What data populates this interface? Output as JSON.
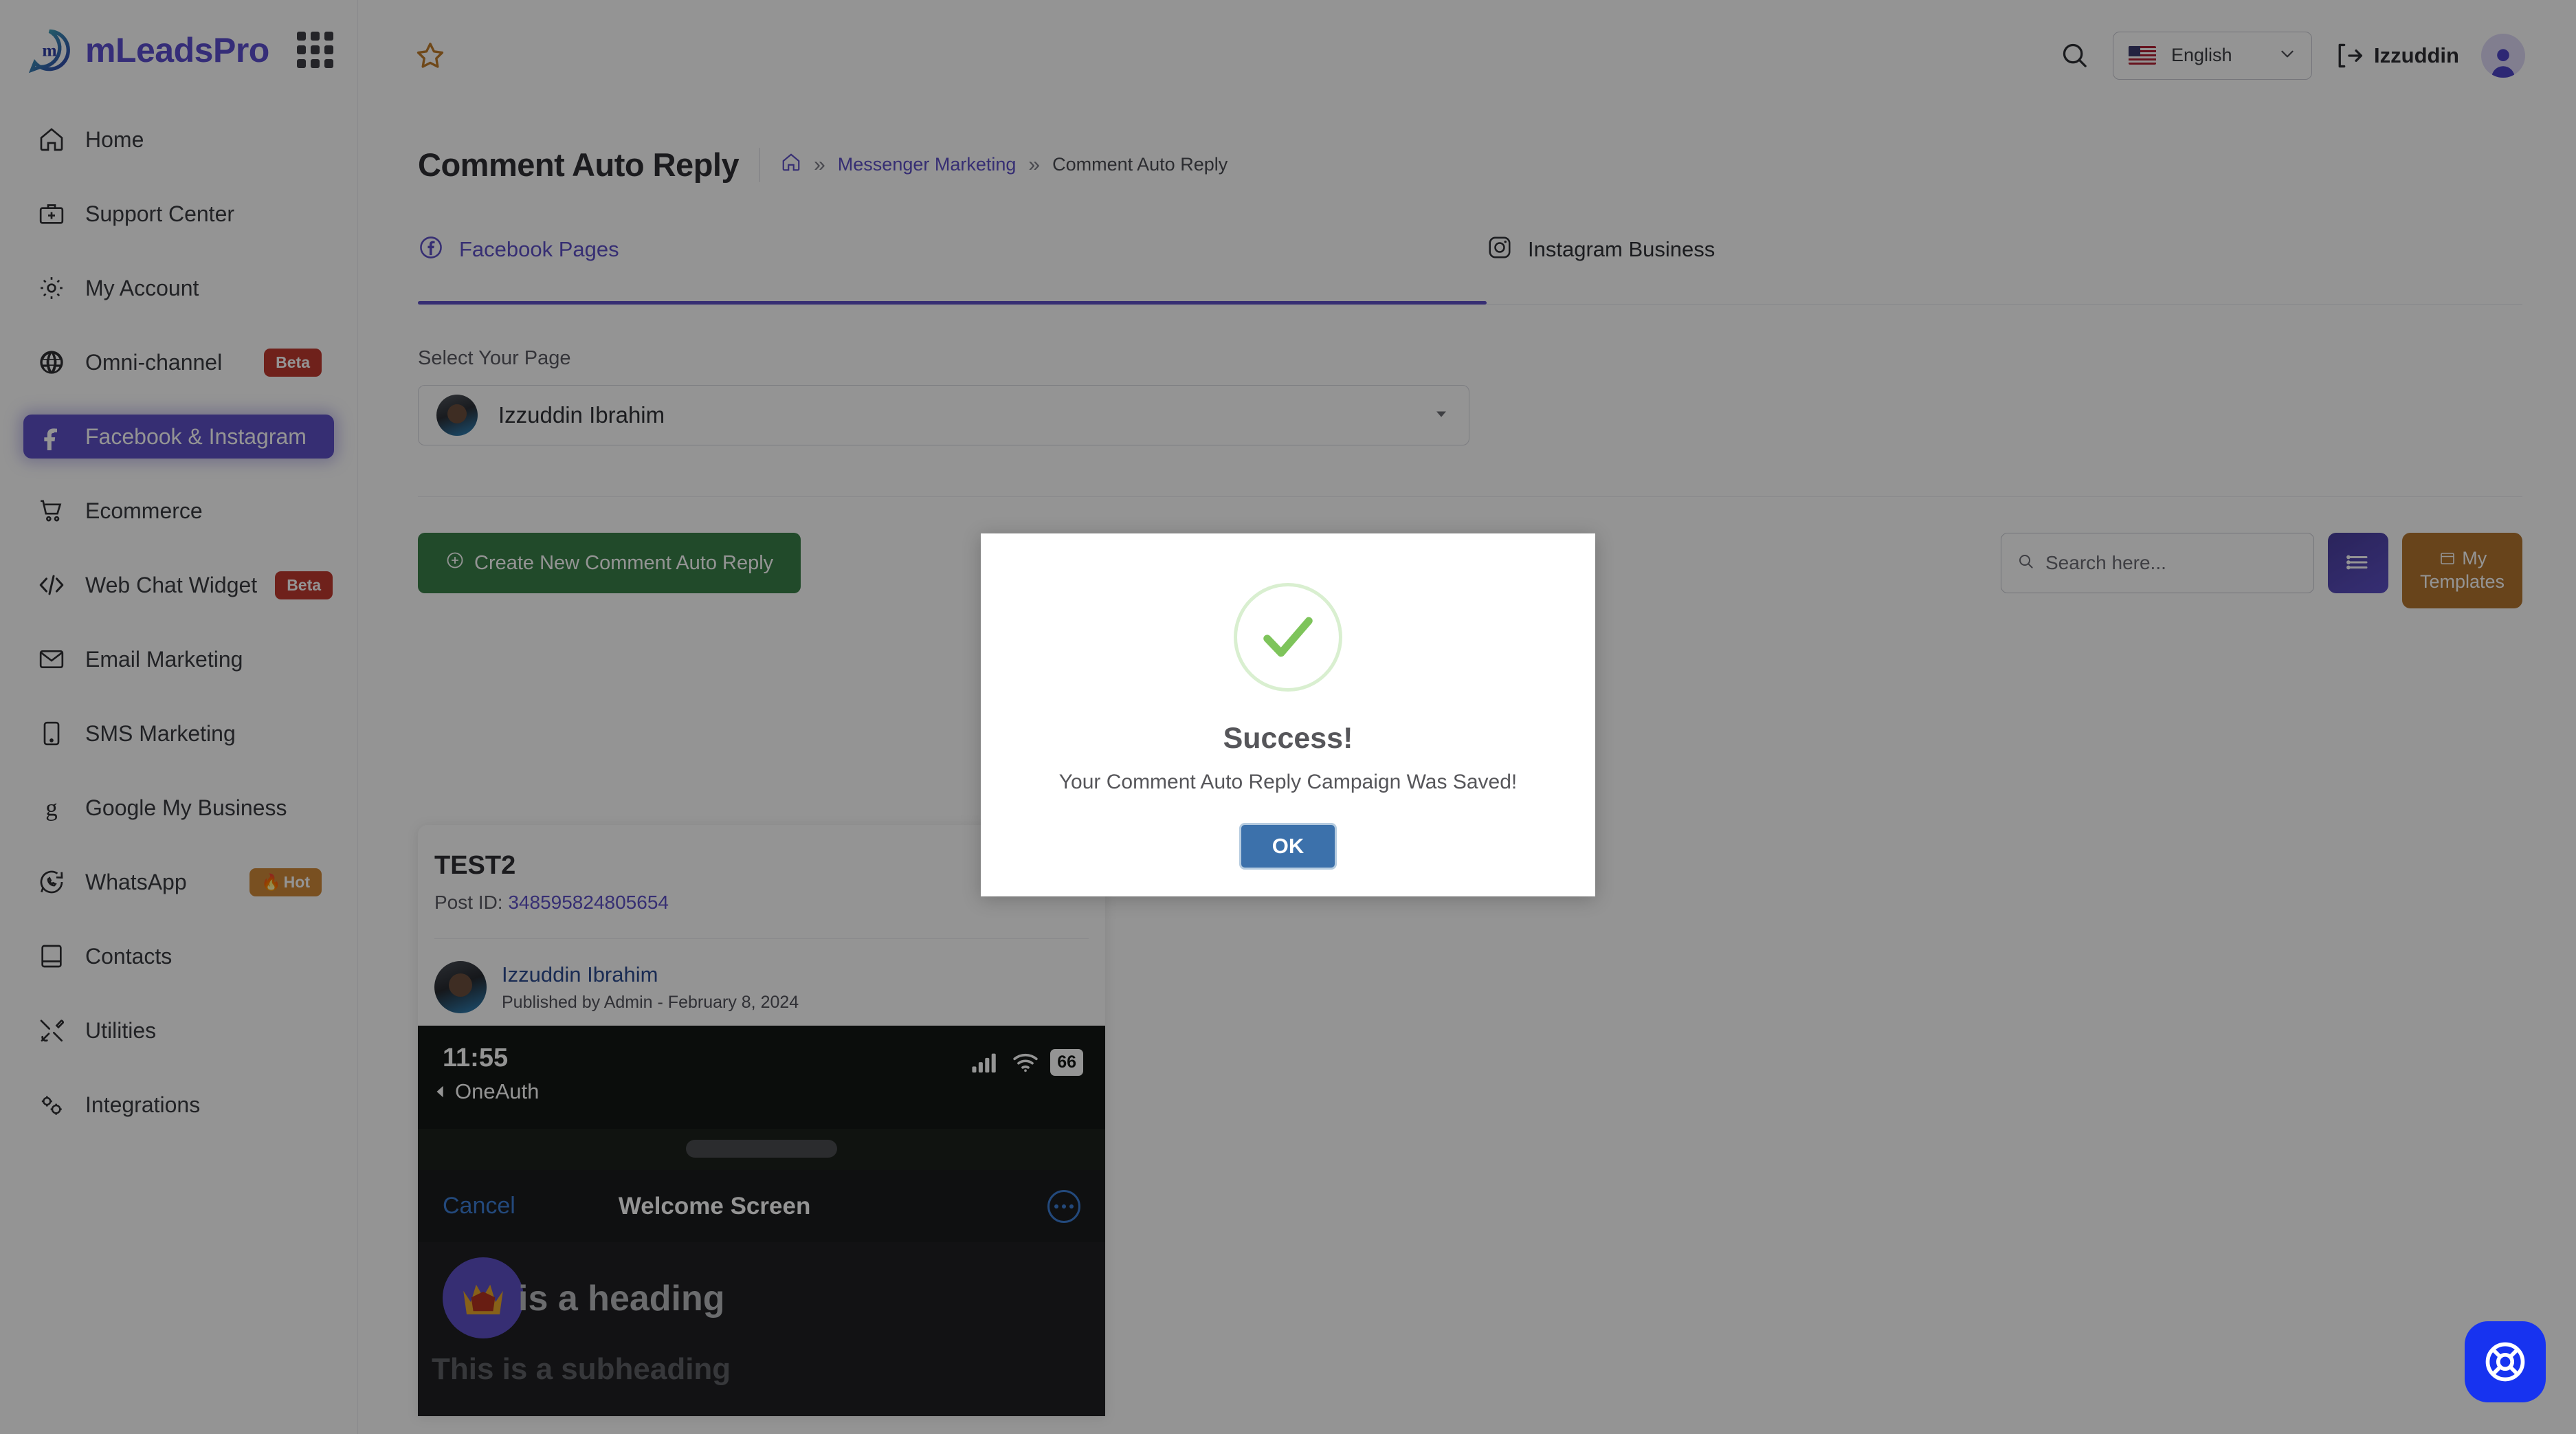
{
  "brand": {
    "name": "mLeadsPro",
    "apps_icon": "apps-grid-icon"
  },
  "sidebar": {
    "items": [
      {
        "label": "Home",
        "icon": "home-icon",
        "badge": null,
        "active": false
      },
      {
        "label": "Support Center",
        "icon": "briefcase-plus-icon",
        "badge": null,
        "active": false
      },
      {
        "label": "My Account",
        "icon": "gear-icon",
        "badge": null,
        "active": false
      },
      {
        "label": "Omni-channel",
        "icon": "globe-icon",
        "badge": "Beta",
        "badge_type": "beta",
        "active": false
      },
      {
        "label": "Facebook & Instagram",
        "icon": "facebook-icon",
        "badge": null,
        "active": true
      },
      {
        "label": "Ecommerce",
        "icon": "cart-icon",
        "badge": null,
        "active": false
      },
      {
        "label": "Web Chat Widget",
        "icon": "code-icon",
        "badge": "Beta",
        "badge_type": "beta",
        "active": false
      },
      {
        "label": "Email Marketing",
        "icon": "envelope-icon",
        "badge": null,
        "active": false
      },
      {
        "label": "SMS Marketing",
        "icon": "phone-icon",
        "badge": null,
        "active": false
      },
      {
        "label": "Google My Business",
        "icon": "google-g-icon",
        "badge": null,
        "active": false
      },
      {
        "label": "WhatsApp",
        "icon": "whatsapp-icon",
        "badge": "Hot",
        "badge_type": "hot",
        "active": false
      },
      {
        "label": "Contacts",
        "icon": "book-icon",
        "badge": null,
        "active": false
      },
      {
        "label": "Utilities",
        "icon": "tools-icon",
        "badge": null,
        "active": false
      },
      {
        "label": "Integrations",
        "icon": "gears-icon",
        "badge": null,
        "active": false
      }
    ]
  },
  "topbar": {
    "favorite_icon": "star-icon",
    "search_icon": "search-icon",
    "language": "English",
    "language_flag": "us-flag-icon",
    "logout_icon": "logout-icon",
    "user_name": "Izzuddin",
    "avatar_icon": "avatar-icon"
  },
  "header": {
    "title": "Comment Auto Reply",
    "breadcrumb": {
      "home_icon": "home-icon",
      "separator": "»",
      "link": "Messenger Marketing",
      "current": "Comment Auto Reply"
    }
  },
  "tabs": [
    {
      "label": "Facebook Pages",
      "icon": "facebook-circle-icon",
      "active": true
    },
    {
      "label": "Instagram Business",
      "icon": "instagram-icon",
      "active": false
    }
  ],
  "select_page": {
    "label": "Select Your Page",
    "value": "Izzuddin Ibrahim",
    "caret_icon": "chevron-down-icon"
  },
  "actions": {
    "create_label": "Create New Comment Auto Reply",
    "create_icon": "plus-circle-icon",
    "search_placeholder": "Search here...",
    "search_value": "",
    "search_icon": "magnifier-icon",
    "list_view_icon": "list-icon",
    "templates_label": "My Templates",
    "templates_icon": "clipboard-icon"
  },
  "campaign_card": {
    "title": "TEST2",
    "post_id_label": "Post ID:",
    "post_id": "348595824805654",
    "author": "Izzuddin Ibrahim",
    "published": "Published by Admin - February 8, 2024",
    "preview": {
      "time": "11:55",
      "back_app": "OneAuth",
      "battery": "66",
      "cancel": "Cancel",
      "screen_title": "Welcome Screen",
      "more_icon": "more-dots-icon",
      "crown_icon": "crown-icon",
      "heading": "is a heading",
      "subheading": "This is a subheading"
    }
  },
  "modal": {
    "icon": "success-check-icon",
    "title": "Success!",
    "message": "Your Comment Auto Reply Campaign Was Saved!",
    "ok_label": "OK"
  },
  "help_fab": {
    "icon": "lifebuoy-icon"
  },
  "colors": {
    "accent_purple": "#5d50c6",
    "green_button": "#3a8049",
    "orange_button": "#b3762f",
    "beta_badge": "#c0392f",
    "hot_badge": "#d08b3a",
    "modal_ok": "#3c71ab",
    "success_green": "#7ec45b",
    "fab_blue": "#1733f0"
  }
}
